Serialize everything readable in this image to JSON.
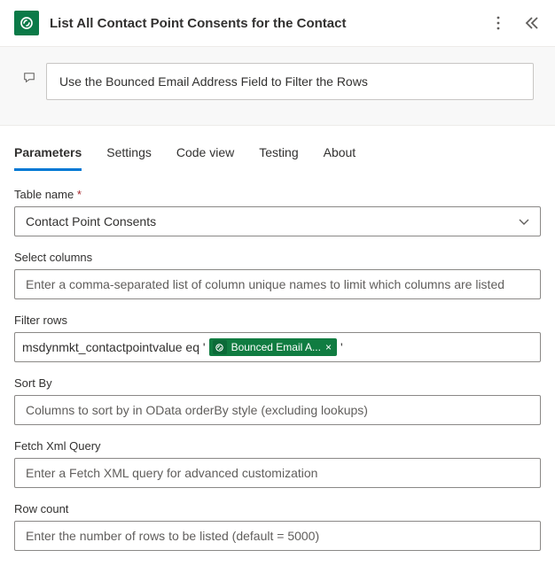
{
  "header": {
    "title": "List All Contact Point Consents for the Contact"
  },
  "comment": {
    "text": "Use the Bounced Email Address Field to Filter the Rows"
  },
  "tabs": {
    "items": [
      {
        "label": "Parameters",
        "active": true
      },
      {
        "label": "Settings",
        "active": false
      },
      {
        "label": "Code view",
        "active": false
      },
      {
        "label": "Testing",
        "active": false
      },
      {
        "label": "About",
        "active": false
      }
    ]
  },
  "form": {
    "table_name": {
      "label": "Table name",
      "required": "*",
      "value": "Contact Point Consents"
    },
    "select_columns": {
      "label": "Select columns",
      "placeholder": "Enter a comma-separated list of column unique names to limit which columns are listed"
    },
    "filter_rows": {
      "label": "Filter rows",
      "prefix": "msdynmkt_contactpointvalue eq '",
      "token": "Bounced Email A...",
      "suffix": "'"
    },
    "sort_by": {
      "label": "Sort By",
      "placeholder": "Columns to sort by in OData orderBy style (excluding lookups)"
    },
    "fetch_xml": {
      "label": "Fetch Xml Query",
      "placeholder": "Enter a Fetch XML query for advanced customization"
    },
    "row_count": {
      "label": "Row count",
      "placeholder": "Enter the number of rows to be listed (default = 5000)"
    }
  }
}
